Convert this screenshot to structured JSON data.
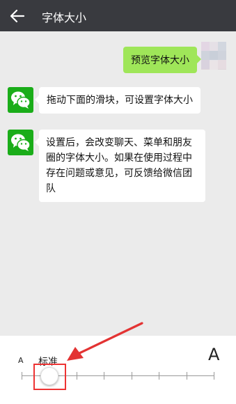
{
  "header": {
    "title": "字体大小"
  },
  "chat": {
    "preview_message": "预览字体大小",
    "instruction_message": "拖动下面的滑块，可设置字体大小",
    "info_lines": [
      "设置后，会改变聊天、菜单和朋友",
      "圈的字体大小。如果在使用过程中",
      "存在问题或意见，可反馈给微信团",
      "队"
    ]
  },
  "font_slider": {
    "small_label": "A",
    "large_label": "A",
    "current_label": "标准",
    "levels": 8,
    "current_level_index": 1
  },
  "colors": {
    "topbar": "#393a3f",
    "sent_bubble": "#9fe659",
    "wechat_green": "#1aad19",
    "annotation_red": "#e33333"
  }
}
